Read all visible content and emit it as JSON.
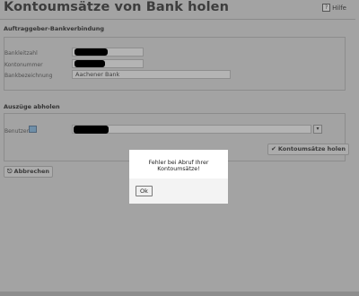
{
  "header": {
    "title": "Kontoumsätze von Bank holen",
    "help_label": "Hilfe"
  },
  "sender": {
    "section_title": "Auftraggeber-Bankverbindung",
    "bank_code_label": "Bankleitzahl",
    "account_label": "Kontonummer",
    "bank_name_label": "Bankbezeichnung",
    "bank_name_value": "Aachener Bank"
  },
  "statements": {
    "section_title": "Auszüge abholen",
    "user_label": "Benutzer",
    "fetch_button": "Kontoumsätze holen"
  },
  "footer": {
    "cancel_button": "Abbrechen"
  },
  "dialog": {
    "message": "Fehler bei Abruf Ihrer Kontoumsätze!",
    "ok_button": "Ok"
  }
}
